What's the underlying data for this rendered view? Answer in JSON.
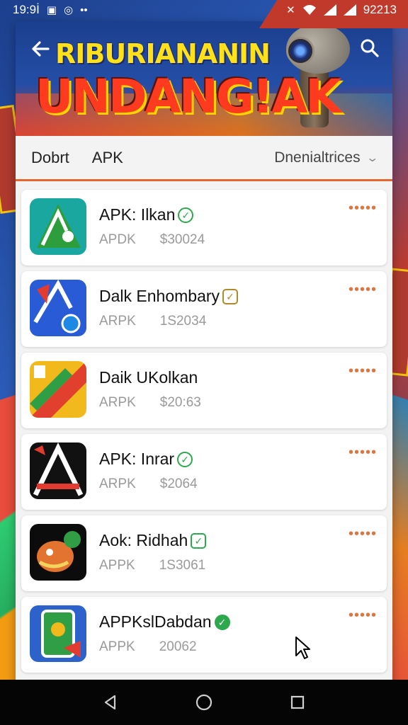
{
  "status_bar": {
    "time": "19:9İ",
    "right_text": "92213"
  },
  "header": {
    "title_line1": "RIBURIANANIN",
    "title_line2": "UNDANG!AK"
  },
  "tabs": [
    {
      "label": "Dobrt"
    },
    {
      "label": "APK"
    }
  ],
  "sort": {
    "label": "Dnenialtrices"
  },
  "apps": [
    {
      "name": "APK: Ilkan",
      "category": "APDK",
      "size": "$30024",
      "badge": "check"
    },
    {
      "name": "Dalk Enhombary",
      "category": "ARPK",
      "size": "1S2034",
      "badge": "square"
    },
    {
      "name": "Daik UKolkan",
      "category": "ARPK",
      "size": "$20:63",
      "badge": "none"
    },
    {
      "name": "APK: Inrar",
      "category": "ARPK",
      "size": "$2064",
      "badge": "check"
    },
    {
      "name": "Aok: Ridhah",
      "category": "APPK",
      "size": "1S3061",
      "badge": "square-green"
    },
    {
      "name": "APPKslDabdan",
      "category": "APPK",
      "size": "20062",
      "badge": "fill"
    }
  ],
  "colors": {
    "accent": "#e5672b",
    "verified": "#2ea84d",
    "header_blue": "#1b3f8f"
  }
}
